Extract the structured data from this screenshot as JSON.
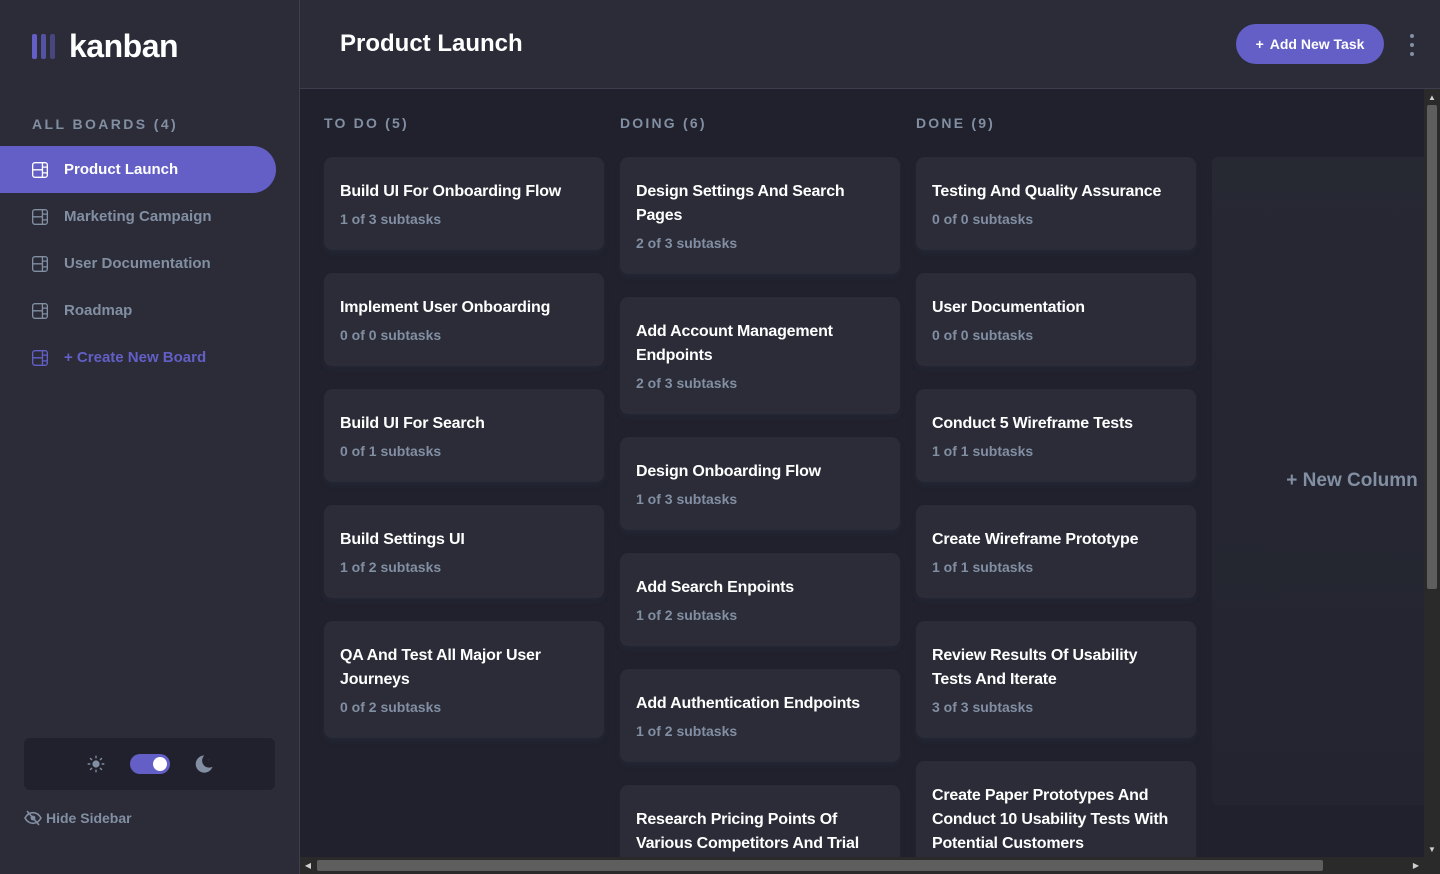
{
  "app": {
    "logo_text": "kanban"
  },
  "colors": {
    "accent": "#635fc7",
    "sidebar_bg": "#2b2c37",
    "board_bg": "#20212c",
    "muted_text": "#828fa3"
  },
  "sidebar": {
    "boards_heading": "ALL BOARDS (4)",
    "boards": [
      {
        "label": "Product Launch",
        "active": true
      },
      {
        "label": "Marketing Campaign",
        "active": false
      },
      {
        "label": "User Documentation",
        "active": false
      },
      {
        "label": "Roadmap",
        "active": false
      }
    ],
    "create_board_label": "+ Create New Board",
    "theme": {
      "icon_light": "sun-icon",
      "icon_dark": "moon-icon",
      "dark_mode": true
    },
    "hide_sidebar_label": "Hide Sidebar"
  },
  "header": {
    "title": "Product Launch",
    "add_task_label": "Add New Task",
    "add_task_icon": "+"
  },
  "columns": [
    {
      "title": "TO DO (5)",
      "cards": [
        {
          "title": "Build UI For Onboarding Flow",
          "subtasks": "1 of 3 subtasks"
        },
        {
          "title": "Implement User Onboarding",
          "subtasks": "0 of 0 subtasks"
        },
        {
          "title": "Build UI For Search",
          "subtasks": "0 of 1 subtasks"
        },
        {
          "title": "Build Settings UI",
          "subtasks": "1 of 2 subtasks"
        },
        {
          "title": "QA And Test All Major User Journeys",
          "subtasks": "0 of 2 subtasks"
        }
      ]
    },
    {
      "title": "DOING (6)",
      "cards": [
        {
          "title": "Design Settings And Search Pages",
          "subtasks": "2 of 3 subtasks"
        },
        {
          "title": "Add Account Management Endpoints",
          "subtasks": "2 of 3 subtasks"
        },
        {
          "title": "Design Onboarding Flow",
          "subtasks": "1 of 3 subtasks"
        },
        {
          "title": "Add Search Enpoints",
          "subtasks": "1 of 2 subtasks"
        },
        {
          "title": "Add Authentication Endpoints",
          "subtasks": "1 of 2 subtasks"
        },
        {
          "title": "Research Pricing Points Of Various Competitors And Trial",
          "subtasks": ""
        }
      ]
    },
    {
      "title": "DONE (9)",
      "cards": [
        {
          "title": "Testing And Quality Assurance",
          "subtasks": "0 of 0 subtasks"
        },
        {
          "title": "User Documentation",
          "subtasks": "0 of 0 subtasks"
        },
        {
          "title": "Conduct 5 Wireframe Tests",
          "subtasks": "1 of 1 subtasks"
        },
        {
          "title": "Create Wireframe Prototype",
          "subtasks": "1 of 1 subtasks"
        },
        {
          "title": "Review Results Of Usability Tests And Iterate",
          "subtasks": "3 of 3 subtasks"
        },
        {
          "title": "Create Paper Prototypes And Conduct 10 Usability Tests With Potential Customers",
          "subtasks": ""
        }
      ]
    }
  ],
  "new_column_label": "+ New Column"
}
